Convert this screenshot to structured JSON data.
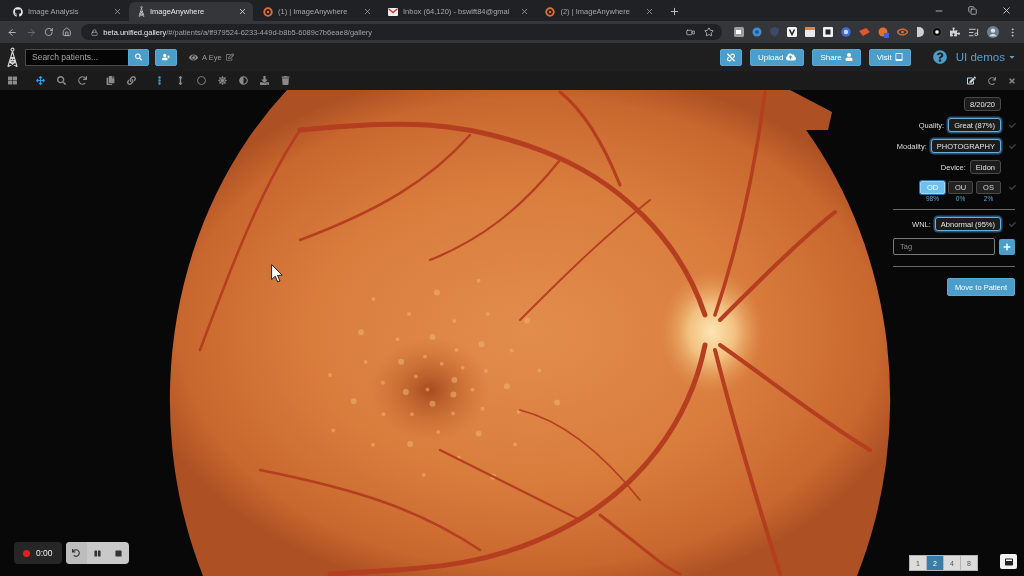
{
  "browser": {
    "tabs": [
      {
        "title": "Image Analysis",
        "kind": "cat",
        "selected": false
      },
      {
        "title": "ImageAnywhere",
        "kind": "tower",
        "selected": true
      },
      {
        "title": "(1) | ImageAnywhere",
        "kind": "ring",
        "selected": false
      },
      {
        "title": "Inbox (64,120) - bswift84@gmai",
        "kind": "envelope",
        "selected": false
      },
      {
        "title": "(2) | ImageAnywhere",
        "kind": "ring",
        "selected": false
      }
    ],
    "url": {
      "host": "beta.unified.gallery",
      "path": "/#/patients/a/ff979524-6233-449d-b8b5-6089c7b6eae8/gallery"
    }
  },
  "app_bar": {
    "search": {
      "placeholder": "Search patients..."
    },
    "patient": "A Eye",
    "actions": [
      {
        "label": "Upload",
        "kind": "upload"
      },
      {
        "label": "Share",
        "kind": "share"
      },
      {
        "label": "Visit",
        "kind": "visit"
      }
    ],
    "user_menu": "UI demos"
  },
  "toolbar": {
    "tool_groups": [
      [
        {
          "kind": "grid",
          "active": false
        }
      ],
      [
        {
          "kind": "move",
          "active": true
        },
        {
          "kind": "zoom",
          "active": false
        },
        {
          "kind": "rotate",
          "active": false
        }
      ],
      [
        {
          "kind": "copy",
          "active": false
        },
        {
          "kind": "link",
          "active": false
        }
      ],
      [
        {
          "kind": "more",
          "active": true
        },
        {
          "kind": "height",
          "active": false
        },
        {
          "kind": "circle",
          "active": false
        },
        {
          "kind": "brightness",
          "active": false
        },
        {
          "kind": "contrast",
          "active": false
        },
        {
          "kind": "download",
          "active": false
        },
        {
          "kind": "delete",
          "active": false
        }
      ]
    ]
  },
  "panel": {
    "date": "8/20/20",
    "fields": [
      {
        "label": "Quality:",
        "value": "Great (87%)",
        "highlighted": true
      },
      {
        "label": "Modality:",
        "value": "PHOTOGRAPHY",
        "highlighted": true
      },
      {
        "label": "Device:",
        "value": "Eidon",
        "highlighted": false
      }
    ],
    "eyes": [
      {
        "label": "OD",
        "share": "98%",
        "selected": true
      },
      {
        "label": "OU",
        "share": "0%",
        "selected": false
      },
      {
        "label": "OS",
        "share": "2%",
        "selected": false
      }
    ],
    "wnl": {
      "label": "WNL:",
      "value": "Abnormal (95%)",
      "highlighted": true
    },
    "tag": {
      "placeholder": "Tag"
    },
    "move_button": "Move to Patient"
  },
  "recorder": {
    "time": "0:00"
  },
  "layouts": [
    {
      "label": "1",
      "selected": false
    },
    {
      "label": "2",
      "selected": true
    },
    {
      "label": "4",
      "selected": false
    },
    {
      "label": "8",
      "selected": false
    }
  ]
}
